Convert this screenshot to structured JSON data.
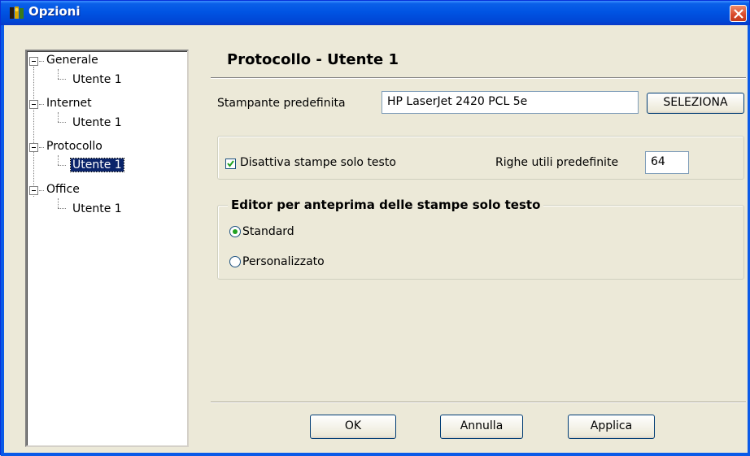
{
  "window": {
    "title": "Opzioni",
    "icon": "app-icon",
    "close_icon": "close-icon"
  },
  "tree": {
    "nodes": [
      {
        "label": "Generale",
        "children": [
          {
            "label": "Utente 1",
            "selected": false
          }
        ]
      },
      {
        "label": "Internet",
        "children": [
          {
            "label": "Utente 1",
            "selected": false
          }
        ]
      },
      {
        "label": "Protocollo",
        "children": [
          {
            "label": "Utente 1",
            "selected": true
          }
        ]
      },
      {
        "label": "Office",
        "children": [
          {
            "label": "Utente 1",
            "selected": false
          }
        ]
      }
    ]
  },
  "panel": {
    "title": "Protocollo - Utente 1",
    "printer_label": "Stampante predefinita",
    "printer_value": "HP LaserJet 2420 PCL 5e",
    "select_button": "SELEZIONA",
    "disable_text_print_label": "Disattiva stampe solo testo",
    "disable_text_print_checked": true,
    "default_rows_label": "Righe utili predefinite",
    "default_rows_value": "64",
    "editor_group_title": "Editor per anteprima delle stampe solo testo",
    "editor_options": [
      {
        "label": "Standard",
        "selected": true
      },
      {
        "label": "Personalizzato",
        "selected": false
      }
    ]
  },
  "buttons": {
    "ok": "OK",
    "cancel": "Annulla",
    "apply": "Applica"
  },
  "colors": {
    "titlebar": "#0054e3",
    "selection": "#0a246a",
    "radio_checked": "#21a121",
    "checkbox_check": "#21a121"
  }
}
